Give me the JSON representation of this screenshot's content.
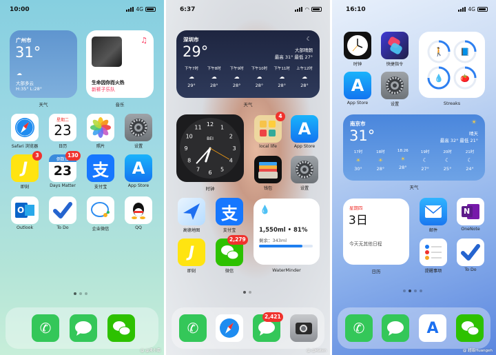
{
  "screen1": {
    "status": {
      "time": "10:00",
      "network": "4G"
    },
    "weather": {
      "city": "广州市",
      "temp": "31°",
      "desc": "大部多云",
      "hl": "H:35° L:28°",
      "label": "天气"
    },
    "music": {
      "song": "生命因你而火热",
      "artist": "新裤子乐队",
      "label": "音乐"
    },
    "apps": [
      {
        "label": "Safari 浏览器",
        "icon": "safari-icon"
      },
      {
        "label": "日历",
        "icon": "calendar-icon",
        "weekday": "星期二",
        "day": "23"
      },
      {
        "label": "照片",
        "icon": "photos-icon"
      },
      {
        "label": "设置",
        "icon": "settings-icon"
      },
      {
        "label": "即刻",
        "icon": "jike-icon",
        "badge": "3"
      },
      {
        "label": "Days Matter",
        "icon": "days-matter-icon",
        "badge": "130",
        "top": "倒数日",
        "day": "23"
      },
      {
        "label": "支付宝",
        "icon": "alipay-icon"
      },
      {
        "label": "App Store",
        "icon": "app-store-icon"
      },
      {
        "label": "Outlook",
        "icon": "outlook-icon"
      },
      {
        "label": "To Do",
        "icon": "todo-icon"
      },
      {
        "label": "企业微信",
        "icon": "wecom-icon"
      },
      {
        "label": "QQ",
        "icon": "qq-icon"
      }
    ],
    "dock": [
      "phone-icon",
      "messages-icon",
      "wechat-icon"
    ],
    "watermark": "@ @来小南"
  },
  "screen2": {
    "status": {
      "time": "6:37"
    },
    "weather": {
      "city": "深圳市",
      "temp": "29°",
      "desc": "大部晴朗",
      "hl": "最高 31° 最低 27°",
      "label": "天气",
      "hours": [
        {
          "t": "下午7时",
          "v": "29°"
        },
        {
          "t": "下午8时",
          "v": "28°"
        },
        {
          "t": "下午9时",
          "v": "28°"
        },
        {
          "t": "下午10时",
          "v": "28°"
        },
        {
          "t": "下午11时",
          "v": "28°"
        },
        {
          "t": "上午12时",
          "v": "28°"
        }
      ]
    },
    "clock": {
      "city": "BEI",
      "label": "时钟",
      "numbers": [
        "12",
        "1",
        "2",
        "3",
        "4",
        "5",
        "6",
        "7",
        "8",
        "9",
        "10",
        "11"
      ]
    },
    "apps": [
      {
        "label": "local life",
        "icon": "folder-icon",
        "badge": "4"
      },
      {
        "label": "App Store",
        "icon": "app-store-icon"
      },
      {
        "label": "钱包",
        "icon": "wallet-icon"
      },
      {
        "label": "设置",
        "icon": "settings-icon"
      },
      {
        "label": "高德地图",
        "icon": "amap-icon"
      },
      {
        "label": "支付宝",
        "icon": "alipay-icon"
      },
      {
        "label": "即刻",
        "icon": "jike-icon"
      },
      {
        "label": "微信",
        "icon": "wechat-icon",
        "badge": "2,279"
      }
    ],
    "waterminder": {
      "amount": "1,550ml • 81%",
      "remain": "剩余：343ml",
      "label": "WaterMinder",
      "progress": 0.81
    },
    "dock": [
      {
        "icon": "phone-icon"
      },
      {
        "icon": "safari-icon"
      },
      {
        "icon": "messages-icon",
        "badge": "2,421"
      },
      {
        "icon": "camera-icon"
      }
    ],
    "watermark": "@ @Raten"
  },
  "screen3": {
    "status": {
      "time": "16:10",
      "network": "4G"
    },
    "apps_top": [
      {
        "label": "时钟",
        "icon": "clock-icon"
      },
      {
        "label": "快捷指令",
        "icon": "shortcuts-icon"
      },
      {
        "label": "App Store",
        "icon": "app-store-icon"
      },
      {
        "label": "设置",
        "icon": "settings-icon"
      }
    ],
    "streaks": {
      "label": "Streaks"
    },
    "weather": {
      "city": "南京市",
      "temp": "31°",
      "desc": "晴天",
      "hl": "最高 32° 最低 21°",
      "label": "天气",
      "hours": [
        {
          "t": "17时",
          "v": "30°"
        },
        {
          "t": "18时",
          "v": "28°"
        },
        {
          "t": "18:26",
          "v": "28°"
        },
        {
          "t": "19时",
          "v": "27°"
        },
        {
          "t": "20时",
          "v": "25°"
        },
        {
          "t": "21时",
          "v": "24°"
        }
      ]
    },
    "calendar": {
      "weekday": "星期四",
      "day": "3日",
      "empty": "今天无其他日程",
      "label": "日历"
    },
    "apps_bottom": [
      {
        "label": "邮件",
        "icon": "mail-icon"
      },
      {
        "label": "OneNote",
        "icon": "onenote-icon"
      },
      {
        "label": "提醒事项",
        "icon": "reminders-icon"
      },
      {
        "label": "To Do",
        "icon": "todo-icon"
      }
    ],
    "dock": [
      "phone-icon",
      "messages-icon",
      "alpha-icon",
      "wechat-icon"
    ],
    "watermark": "@ 超级Huangeh"
  }
}
